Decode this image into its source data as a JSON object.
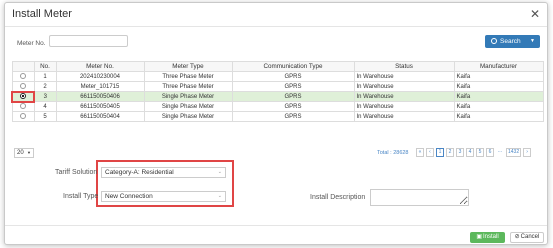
{
  "dialog": {
    "title": "Install Meter",
    "close_icon": "close-icon"
  },
  "search": {
    "meter_no_label": "Meter No.",
    "meter_no_value": "",
    "button_label": "Search"
  },
  "table": {
    "headers": [
      "",
      "No.",
      "Meter No.",
      "Meter Type",
      "Communication Type",
      "Status",
      "Manufacturer"
    ],
    "rows": [
      {
        "no": "1",
        "meter_no": "202410230004",
        "meter_type": "Three Phase Meter",
        "comm": "GPRS",
        "status": "In Warehouse",
        "manufacturer": "Kaifa",
        "selected": false
      },
      {
        "no": "2",
        "meter_no": "Meter_101715",
        "meter_type": "Three Phase Meter",
        "comm": "GPRS",
        "status": "In Warehouse",
        "manufacturer": "Kaifa",
        "selected": false
      },
      {
        "no": "3",
        "meter_no": "661150050406",
        "meter_type": "Single Phase Meter",
        "comm": "GPRS",
        "status": "In Warehouse",
        "manufacturer": "Kaifa",
        "selected": true
      },
      {
        "no": "4",
        "meter_no": "661150050405",
        "meter_type": "Single Phase Meter",
        "comm": "GPRS",
        "status": "In Warehouse",
        "manufacturer": "Kaifa",
        "selected": false
      },
      {
        "no": "5",
        "meter_no": "661150050404",
        "meter_type": "Single Phase Meter",
        "comm": "GPRS",
        "status": "In Warehouse",
        "manufacturer": "Kaifa",
        "selected": false
      }
    ]
  },
  "pager": {
    "page_size": "20",
    "total": "Total : 28628",
    "pages": [
      "«",
      "‹",
      "1",
      "2",
      "3",
      "4",
      "5",
      "6",
      "...",
      "1432",
      "›"
    ],
    "active_page": "1"
  },
  "form": {
    "tariff_label": "Tariff Solution",
    "tariff_value": "Category-A: Residential",
    "install_type_label": "Install Type",
    "install_type_value": "New Connection",
    "install_desc_label": "Install Description",
    "install_desc_value": ""
  },
  "footer": {
    "install_label": "Install",
    "cancel_label": "Cancel"
  },
  "colors": {
    "primary": "#337ab7",
    "success": "#5cb85c",
    "selected_row": "#dff0d8",
    "highlight": "#e04545"
  }
}
